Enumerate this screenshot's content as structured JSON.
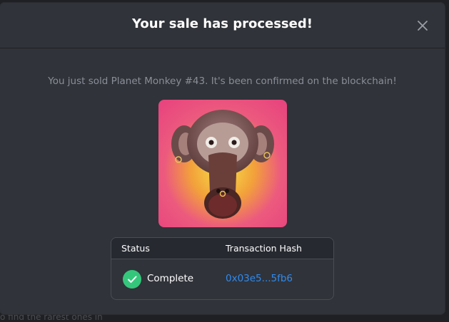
{
  "backdrop": {
    "partial_text": "o find the rarest ones in"
  },
  "modal": {
    "title": "Your sale has processed!",
    "message": "You just sold Planet Monkey #43. It's been confirmed on the blockchain!",
    "close_icon": "close-icon",
    "nft_image_icon": "monkey-artwork"
  },
  "table": {
    "headers": [
      "Status",
      "Transaction Hash"
    ],
    "rows": [
      {
        "status": "Complete",
        "status_icon": "check-circle-icon",
        "hash": "0x03e5...5fb6"
      }
    ]
  },
  "colors": {
    "modal_bg": "#303339",
    "accent_link": "#2e8bf0",
    "success": "#34c77b",
    "nft_bg": "#e8457e"
  }
}
